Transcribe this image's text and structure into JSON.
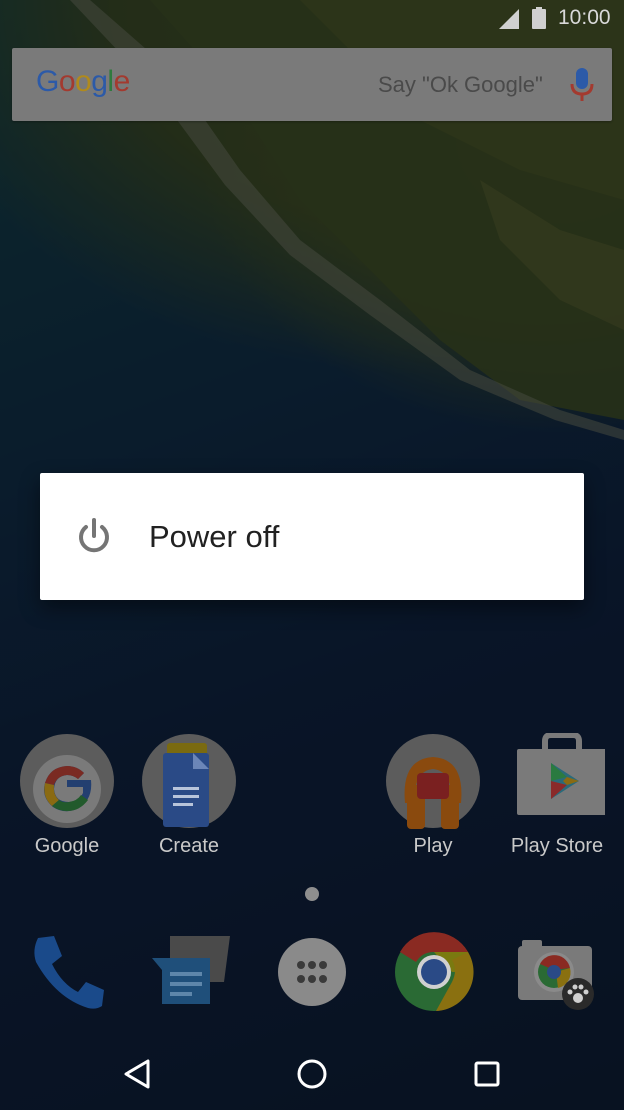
{
  "status_bar": {
    "time": "10:00"
  },
  "search_bar": {
    "logo": [
      "G",
      "o",
      "o",
      "g",
      "l",
      "e"
    ],
    "hint": "Say \"Ok Google\""
  },
  "power_dialog": {
    "label": "Power off"
  },
  "home_apps": [
    {
      "label": "Google",
      "icon": "google-folder-icon"
    },
    {
      "label": "Create",
      "icon": "create-folder-icon"
    },
    {
      "label": "Play",
      "icon": "play-folder-icon"
    },
    {
      "label": "Play Store",
      "icon": "play-store-icon"
    }
  ],
  "dock": [
    {
      "icon": "phone-icon"
    },
    {
      "icon": "messages-icon"
    },
    {
      "icon": "app-drawer-icon"
    },
    {
      "icon": "chrome-icon"
    },
    {
      "icon": "camera-icon"
    }
  ],
  "nav_bar": {
    "back": "back-icon",
    "home": "home-icon",
    "recents": "recents-icon"
  },
  "colors": {
    "google_blue": "#4285f4",
    "google_red": "#ea4335",
    "google_yellow": "#fbbc05",
    "google_green": "#34a853",
    "dialog_bg": "#ffffff",
    "dim_overlay": "rgba(0,0,0,0.55)"
  }
}
